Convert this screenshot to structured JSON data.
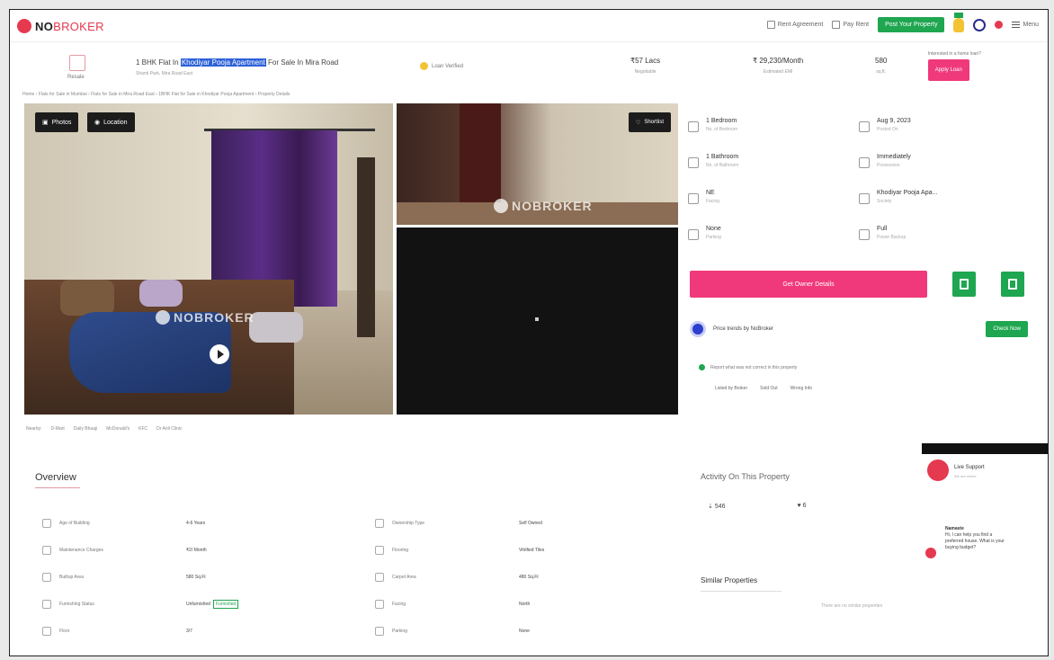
{
  "header": {
    "logo_bold": "NO",
    "logo_light": "BROKER",
    "links": [
      "Rent Agreement",
      "Pay Rent"
    ],
    "post_property": "Post Your Property",
    "menu": "Menu"
  },
  "property": {
    "category_label": "Resale",
    "title_before": "1 BHK Flat In",
    "title_highlight": "Khodiyar Pooja Apartment",
    "title_after": "For Sale In Mira Road",
    "subtitle": "Shanti Park, Mira Road East",
    "verified": "Loan Verified",
    "price": "₹57 Lacs",
    "price_label": "Negotiable",
    "emi": "₹ 29,230/Month",
    "emi_label": "Estimated EMI",
    "area": "580",
    "area_label": "sq.ft.",
    "apply_caption": "Interested in a home loan?",
    "apply_button": "Apply Loan"
  },
  "breadcrumb": "Home › Flats for Sale in Mumbai › Flats for Sale in Mira Road East › 1BHK Flat for Sale in Khodiyar Pooja Apartment › Property Details",
  "gallery": {
    "photos": "Photos",
    "location": "Location",
    "shortlist": "Shortlist",
    "watermark": "NOBROKER"
  },
  "details": [
    {
      "value": "1 Bedroom",
      "label": "No. of Bedroom"
    },
    {
      "value": "Aug 9, 2023",
      "label": "Posted On"
    },
    {
      "value": "1 Bathroom",
      "label": "No. of Bathroom"
    },
    {
      "value": "Immediately",
      "label": "Possession"
    },
    {
      "value": "NE",
      "label": "Facing"
    },
    {
      "value": "Khodiyar Pooja Apa...",
      "label": "Society"
    },
    {
      "value": "None",
      "label": "Parking"
    },
    {
      "value": "Full",
      "label": "Power Backup"
    }
  ],
  "actions": {
    "owner": "Get Owner Details",
    "estimate": "Price trends by NoBroker",
    "check": "Check Now",
    "report": "Report what was not correct in this property",
    "report_links": [
      "Listed by Broker",
      "Sold Out",
      "Wrong Info"
    ]
  },
  "nearby": [
    "Nearby:",
    "D-Mart",
    "Daily Bhaaji",
    "McDonald's",
    "KFC",
    "Dr Anil Clinic"
  ],
  "overview": {
    "title": "Overview",
    "items": [
      {
        "label": "Age of Building",
        "value": "4-6 Years"
      },
      {
        "label": "Ownership Type",
        "value": "Self Owned"
      },
      {
        "label": "Maintenance Charges",
        "value": "₹2/ Month"
      },
      {
        "label": "Flooring",
        "value": "Vitrified Tiles"
      },
      {
        "label": "Builtup Area",
        "value": "580 Sq.Ft"
      },
      {
        "label": "Carpet Area",
        "value": "480 Sq.Ft"
      },
      {
        "label": "Furnishing Status",
        "value": "Unfurnished",
        "tag": "Furnished"
      },
      {
        "label": "Facing",
        "value": "North"
      },
      {
        "label": "Floor",
        "value": "3/7"
      },
      {
        "label": "Parking",
        "value": "None"
      }
    ]
  },
  "activity": {
    "title": "Activity On This Property",
    "views": "546",
    "shortlists": "6"
  },
  "similar": {
    "title": "Similar Properties",
    "note": "There are no similar properties"
  },
  "chat": {
    "name": "Live Support",
    "status": "We are online",
    "greeting": "Namaste",
    "message": "Hi, I can help you find a preferred house. What is your buying budget?"
  },
  "colors": {
    "brand": "#e53950",
    "green": "#1fa650",
    "pink": "#f0397a",
    "highlight": "#2c61d8"
  }
}
